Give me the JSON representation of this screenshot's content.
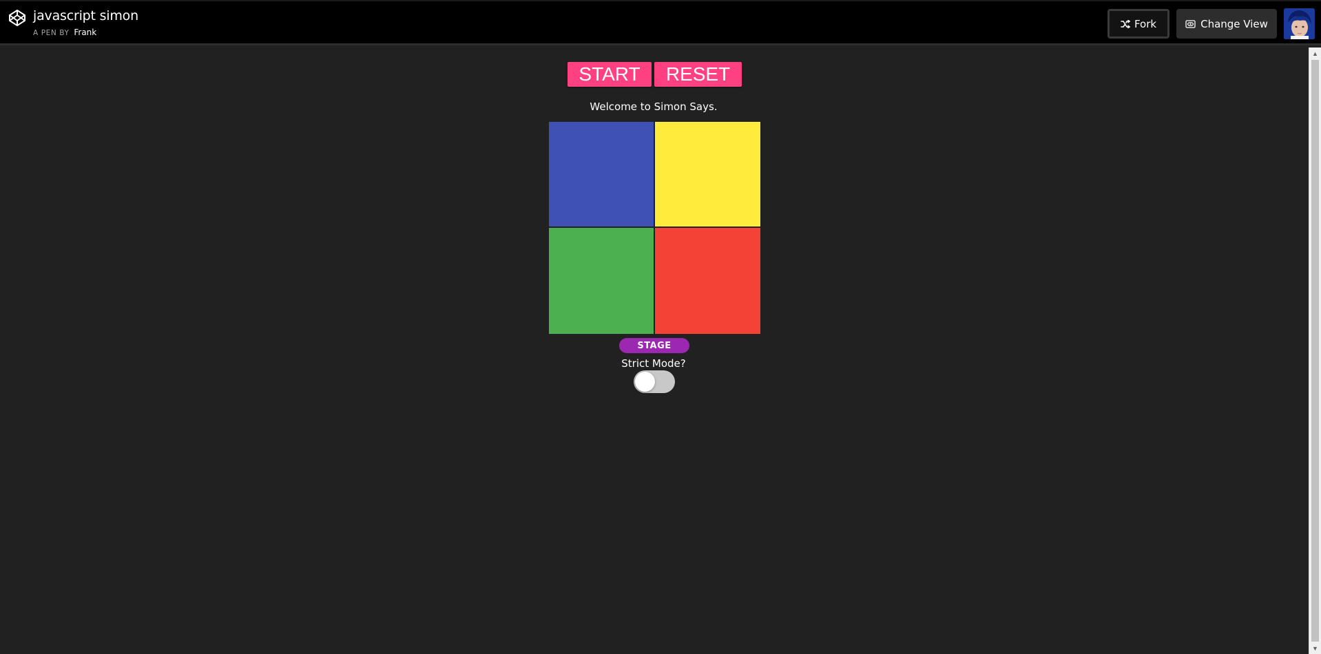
{
  "header": {
    "title": "javascript simon",
    "by_label": "A PEN BY",
    "author": "Frank",
    "fork_label": "Fork",
    "change_view_label": "Change View",
    "logo_icon": "codepen-icon",
    "fork_icon": "fork-icon",
    "view_icon": "eye-icon"
  },
  "game": {
    "start_label": "START",
    "reset_label": "RESET",
    "welcome_text": "Welcome to Simon Says.",
    "pads": [
      {
        "name": "blue",
        "color": "#3f51b5"
      },
      {
        "name": "yellow",
        "color": "#ffeb3b"
      },
      {
        "name": "green",
        "color": "#4caf50"
      },
      {
        "name": "red",
        "color": "#f44336"
      }
    ],
    "stage_label": "STAGE",
    "strict_label": "Strict Mode?",
    "strict_on": false
  },
  "colors": {
    "background": "#212121",
    "button_accent": "#ff4081",
    "stage_badge": "#9c27b0",
    "toggle_track": "#c8c8c8"
  }
}
